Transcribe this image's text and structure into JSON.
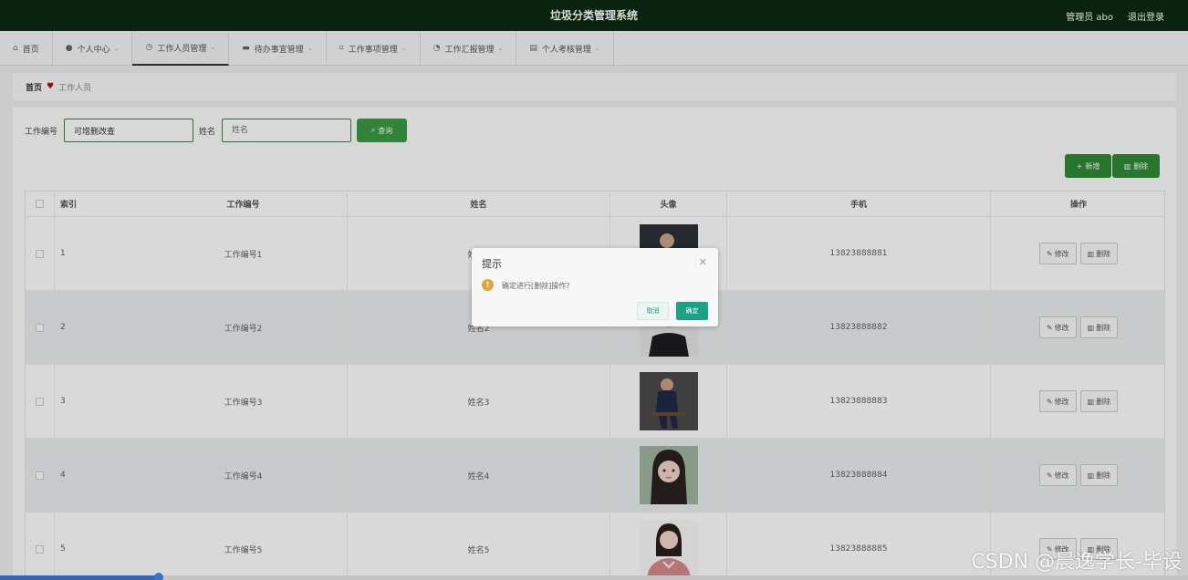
{
  "header": {
    "title": "垃圾分类管理系统",
    "user": "管理员 abo",
    "logout": "退出登录"
  },
  "nav": [
    {
      "icon": "home-icon",
      "label": "首页",
      "dropdown": false
    },
    {
      "icon": "user-icon",
      "label": "个人中心",
      "dropdown": true
    },
    {
      "icon": "clock-icon",
      "label": "工作人员管理",
      "dropdown": true,
      "active": true
    },
    {
      "icon": "monitor-icon",
      "label": "待办事宜管理",
      "dropdown": true
    },
    {
      "icon": "crop-icon",
      "label": "工作事项管理",
      "dropdown": true
    },
    {
      "icon": "dashboard-icon",
      "label": "工作汇报管理",
      "dropdown": true
    },
    {
      "icon": "briefcase-icon",
      "label": "个人考核管理",
      "dropdown": true
    }
  ],
  "breadcrumb": {
    "home": "首页",
    "current": "工作人员"
  },
  "search": {
    "id_label": "工作编号",
    "id_value": "可增删改查",
    "name_label": "姓名",
    "name_placeholder": "姓名",
    "query_button": "查询"
  },
  "toolbar": {
    "add_button": "新增",
    "delete_button": "删除"
  },
  "table": {
    "headers": {
      "index": "索引",
      "work_id": "工作编号",
      "name": "姓名",
      "avatar": "头像",
      "phone": "手机",
      "actions": "操作"
    },
    "edit_label": "修改",
    "delete_label": "删除",
    "rows": [
      {
        "index": "1",
        "work_id": "工作编号1",
        "name": "姓名1",
        "phone": "13823888881"
      },
      {
        "index": "2",
        "work_id": "工作编号2",
        "name": "姓名2",
        "phone": "13823888882"
      },
      {
        "index": "3",
        "work_id": "工作编号3",
        "name": "姓名3",
        "phone": "13823888883"
      },
      {
        "index": "4",
        "work_id": "工作编号4",
        "name": "姓名4",
        "phone": "13823888884"
      },
      {
        "index": "5",
        "work_id": "工作编号5",
        "name": "姓名5",
        "phone": "13823888885"
      }
    ]
  },
  "dialog": {
    "title": "提示",
    "message": "确定进行[删除]操作?",
    "cancel": "取消",
    "confirm": "确定"
  },
  "watermark": "CSDN @晨逸学长-毕设",
  "colors": {
    "header": "#0b2a14",
    "primary_green": "#3c9b44",
    "dialog_confirm": "#1aa186",
    "warning": "#e6a23c"
  }
}
